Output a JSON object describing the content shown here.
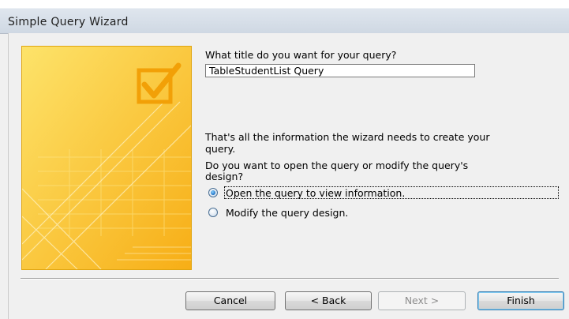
{
  "window": {
    "title": "Simple Query Wizard"
  },
  "form": {
    "title_prompt": "What title do you want for your query?",
    "title_value": "TableStudentList Query",
    "info_line1": "That's all the information the wizard needs to create your",
    "info_line2": "query.",
    "question_line1": "Do you want to open the query or modify the query's",
    "question_line2": "design?",
    "options": [
      {
        "label": "Open the query to view information.",
        "selected": true
      },
      {
        "label": "Modify the query design.",
        "selected": false
      }
    ]
  },
  "buttons": {
    "cancel": "Cancel",
    "back": "< Back",
    "next": "Next >",
    "finish": "Finish"
  },
  "colors": {
    "art_yellow": "#fbc02d",
    "accent_blue": "#1c6fc2"
  },
  "icons": {
    "art": "checkbox-check-illustration"
  }
}
